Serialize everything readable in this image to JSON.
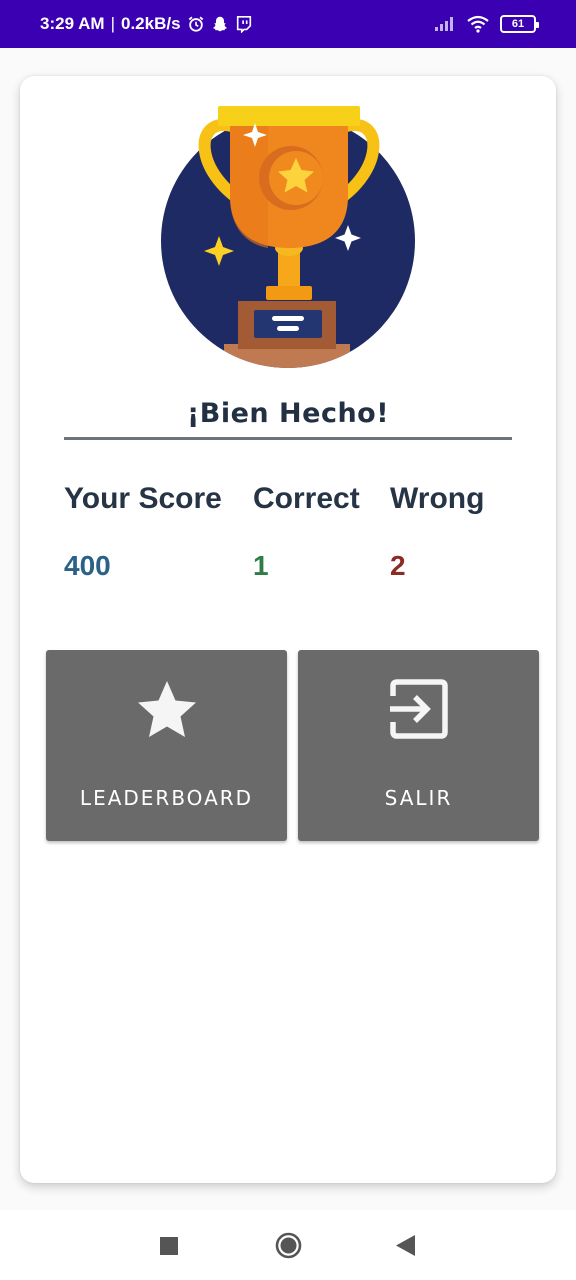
{
  "status_bar": {
    "time": "3:29 AM",
    "separator": "|",
    "speed": "0.2kB/s",
    "battery": "61",
    "icons": [
      "alarm-icon",
      "snapchat-icon",
      "twitch-icon",
      "signal-icon",
      "wifi-icon",
      "battery-icon"
    ]
  },
  "result": {
    "title": "¡Bien Hecho!"
  },
  "stats": {
    "score_label": "Your Score",
    "correct_label": "Correct",
    "wrong_label": "Wrong",
    "score_value": "400",
    "correct_value": "1",
    "wrong_value": "2"
  },
  "colors": {
    "status_bar": "#3a00b2",
    "score": "#2b6186",
    "correct": "#2e7d45",
    "wrong": "#8c2a24",
    "button_bg": "#6a6a6a",
    "trophy_circle": "#1d2a63"
  },
  "buttons": {
    "leaderboard_label": "LEADERBOARD",
    "leaderboard_icon": "star-icon",
    "exit_label": "SALIR",
    "exit_icon": "exit-icon"
  },
  "nav": {
    "icons": [
      "recents-square-icon",
      "home-circle-icon",
      "back-triangle-icon"
    ]
  }
}
